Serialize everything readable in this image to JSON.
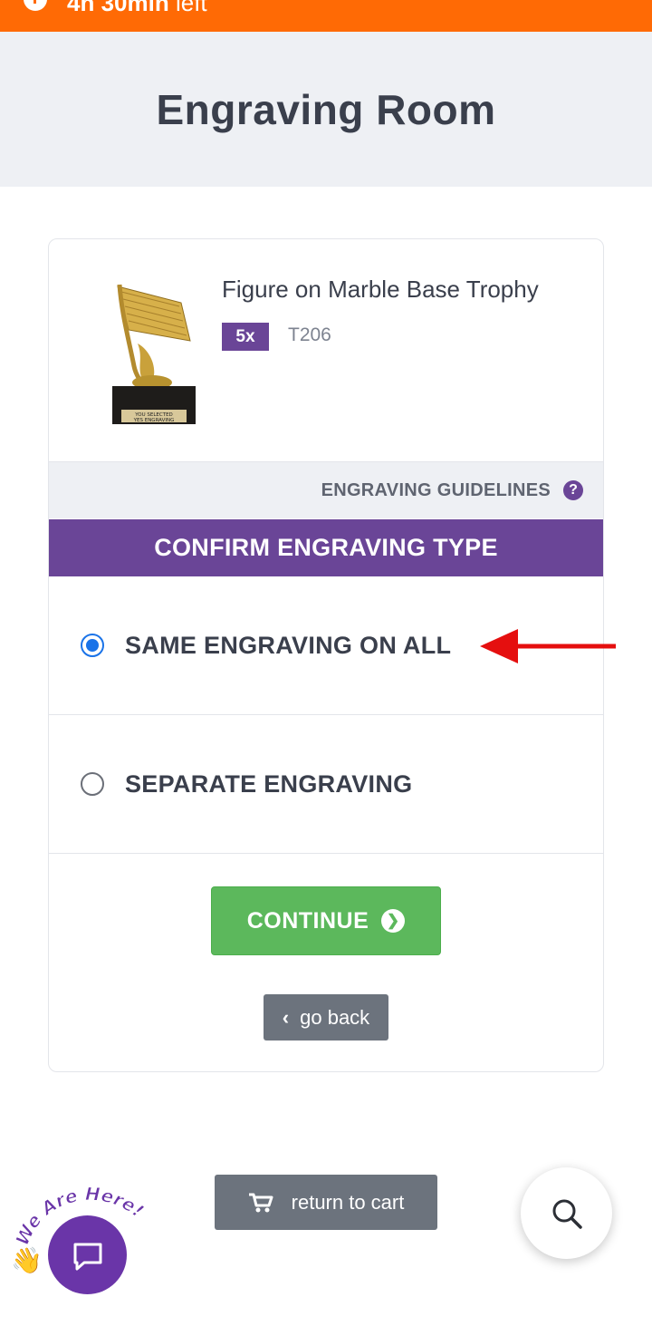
{
  "top_bar": {
    "timer_strong": "4h 30min",
    "timer_rest": "left",
    "color": "#ff6a05"
  },
  "header": {
    "title": "Engraving Room"
  },
  "product": {
    "name": "Figure on Marble Base Trophy",
    "quantity": "5x",
    "sku": "T206",
    "image_caption_line1": "YOU SELECTED",
    "image_caption_line2": "YES ENGRAVING"
  },
  "guidelines": {
    "label": "ENGRAVING GUIDELINES",
    "icon": "question-circle-icon"
  },
  "confirm": {
    "title": "CONFIRM ENGRAVING TYPE",
    "color": "#6a4597"
  },
  "options": [
    {
      "label": "SAME ENGRAVING ON ALL",
      "selected": true
    },
    {
      "label": "SEPARATE ENGRAVING",
      "selected": false
    }
  ],
  "actions": {
    "continue_label": "CONTINUE",
    "continue_color": "#5cb85c",
    "go_back_label": "go back",
    "return_to_cart_label": "return to cart"
  },
  "chat_widget": {
    "badge_text": "We Are Here!"
  }
}
